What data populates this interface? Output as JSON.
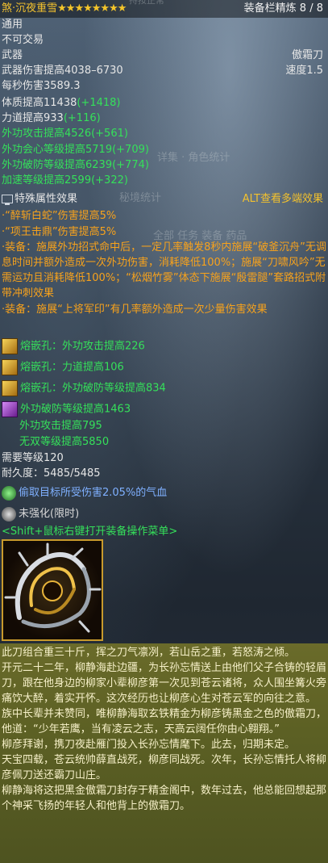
{
  "header": {
    "name": "煞·沉夜重雪",
    "stars": "★★★★★★★★",
    "faint_tab": "持按正常",
    "refine": "装备栏精炼 8 / 8"
  },
  "meta": {
    "slot": "通用",
    "trade": "不可交易",
    "type": "武器",
    "weapon_name": "傲霜刀",
    "damage": "武器伤害提高4038–6730",
    "speed": "速度1.5",
    "dps": "每秒伤害3589.3"
  },
  "attrs": [
    {
      "text": "体质提高11438",
      "bonus": "(+1418)"
    },
    {
      "text": "力道提高933",
      "bonus": "(+116)"
    },
    {
      "text": "外功攻击提高4526",
      "bonus": "(+561)"
    },
    {
      "text": "外功会心等级提高5719",
      "bonus": "(+709)"
    },
    {
      "text": "外功破防等级提高6239",
      "bonus": "(+774)"
    },
    {
      "text": "加速等级提高2599",
      "bonus": "(+322)"
    }
  ],
  "faint_bg": {
    "tabs1": "详集 · 角色统计",
    "tabs2": "秘境统计",
    "tabs3": "全部   任务   装备   药品"
  },
  "special": {
    "title": "特殊属性效果",
    "alt_hint": "ALT查看多端效果",
    "lines": [
      "·“醉斩白蛇”伤害提高5%",
      "·“项王击鼎”伤害提高5%"
    ],
    "equip1": "·装备：施展外功招式命中后，一定几率触发8秒内施展“破釜沉舟”无调息时间并额外造成一次外功伤害，消耗降低100%；施展“刀啸风吟”无需运功且消耗降低100%；“松烟竹雾”体态下施展“殷雷腿”套路招式附带冲刺效果",
    "equip2": "·装备：施展“上将军印”有几率额外造成一次少量伤害效果"
  },
  "gems": [
    {
      "text": "熔嵌孔：外功攻击提高226"
    },
    {
      "text": "熔嵌孔：力道提高106"
    },
    {
      "text": "熔嵌孔：外功破防等级提高834"
    }
  ],
  "five_color": [
    "外功破防等级提高1463",
    "外功攻击提高795",
    "无双等级提高5850"
  ],
  "level": "需要等级120",
  "durability": "耐久度：5485/5485",
  "enchant1": "偷取目标所受伤害2.05%的气血",
  "enchant2": "未强化(限时)",
  "menu_hint": "<Shift+鼠标右键打开装备操作菜单>",
  "description": [
    "此刀组合重三十斤，挥之刀气凛冽，若山岳之重，若怒涛之倾。",
    "开元二十二年，柳静海赴边疆，为长孙忘情送上由他们父子合铸的轻眉刀，跟在他身边的柳家小辈柳彦第一次见到苍云诸将，众人围坐篝火旁痛饮大醉，着实开怀。这次经历也让柳彦心生对苍云军的向往之意。",
    "族中长辈并未赞同，唯柳静海取玄铁精金为柳彦铸黑金之色的傲霜刀，他道：“少年若鹰，当有凌云之志，天高云阔任你由心翱翔。”",
    "柳彦拜谢，携刀夜赴雁门投入长孙忘情麾下。此去，归期未定。",
    "天宝四载，苍云统帅薛直战死，柳彦同战死。次年，长孙忘情托人将柳彦佩刀送还霸刀山庄。",
    "柳静海将这把黑金傲霜刀封存于精金阁中，数年过去，他总能回想起那个神采飞扬的年轻人和他背上的傲霜刀。"
  ],
  "colors": {
    "gold": "#f2c12e",
    "green": "#35e05a",
    "orange": "#f7a21c",
    "frame": "#c89a2c"
  }
}
